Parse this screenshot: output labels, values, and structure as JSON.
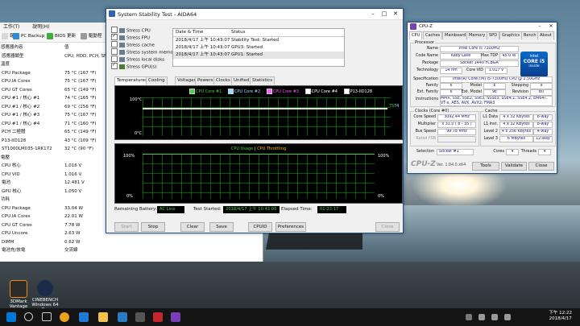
{
  "desktop": {
    "icons": [
      {
        "label": "3DMark Vantage"
      },
      {
        "label": "CINEBENCH Windows 64 B..."
      }
    ]
  },
  "sensor_window": {
    "menu": [
      "工作(T)",
      "說明(H)"
    ],
    "toolbar": [
      "報告",
      "PC Backup",
      "BIOS 更新",
      "驅動程"
    ],
    "header_col": "值",
    "rows": [
      {
        "name": "感應器內容",
        "value": ""
      },
      {
        "name": "感應器類型",
        "value": "CPU, HDD, PCH, SNB"
      },
      {
        "name": "溫度",
        "value": ""
      },
      {
        "name": "CPU Package",
        "value": "75 °C  (167 °F)"
      },
      {
        "name": "CPU IA Cores",
        "value": "75 °C  (167 °F)"
      },
      {
        "name": "CPU GT Cores",
        "value": "65 °C  (149 °F)"
      },
      {
        "name": "CPU #1 / 核心 #1",
        "value": "74 °C  (165 °F)"
      },
      {
        "name": "CPU #1 / 核心 #2",
        "value": "69 °C  (156 °F)"
      },
      {
        "name": "CPU #1 / 核心 #3",
        "value": "75 °C  (167 °F)"
      },
      {
        "name": "CPU #1 / 核心 #4",
        "value": "71 °C  (160 °F)"
      },
      {
        "name": "PCH 二極體",
        "value": "65 °C  (149 °F)"
      },
      {
        "name": "P13-IID128",
        "value": "43 °C  (109 °F)"
      },
      {
        "name": "ST1000LM035-1RK172",
        "value": "32 °C  (90 °F)"
      },
      {
        "name": "電壓",
        "value": ""
      },
      {
        "name": "CPU 核心",
        "value": "1.016 V"
      },
      {
        "name": "CPU VID",
        "value": "1.016 V"
      },
      {
        "name": "電池",
        "value": "12.481 V"
      },
      {
        "name": "GPU 核心",
        "value": "1.050 V"
      },
      {
        "name": "功耗",
        "value": ""
      },
      {
        "name": "CPU Package",
        "value": "33.04 W"
      },
      {
        "name": "CPU IA Cores",
        "value": "22.01 W"
      },
      {
        "name": "CPU GT Cores",
        "value": "7.78 W"
      },
      {
        "name": "CPU Uncore",
        "value": "2.63 W"
      },
      {
        "name": "DIMM",
        "value": "0.62 W"
      },
      {
        "name": "電池充/放電",
        "value": "交流線"
      }
    ]
  },
  "aida": {
    "title": "System Stability Test - AIDA64",
    "stress_options": [
      {
        "label": "Stress CPU",
        "checked": false
      },
      {
        "label": "Stress FPU",
        "checked": true
      },
      {
        "label": "Stress cache",
        "checked": false
      },
      {
        "label": "Stress system memory",
        "checked": false
      },
      {
        "label": "Stress local disks",
        "checked": false
      },
      {
        "label": "Stress GPU(s)",
        "checked": true
      }
    ],
    "log_headers": {
      "datetime": "Date & Time",
      "status": "Status"
    },
    "log": [
      {
        "datetime": "2018/4/17 上午 10:43:07",
        "status": "Stability Test: Started"
      },
      {
        "datetime": "2018/4/17 上午 10:43:07",
        "status": "GPU3: Started"
      },
      {
        "datetime": "2018/4/17 上午 10:43:07",
        "status": "GPU1: Started"
      }
    ],
    "tabs": [
      "Temperatures",
      "Cooling Fans",
      "Voltages",
      "Powers",
      "Clocks",
      "Unified",
      "Statistics"
    ],
    "temp_graph": {
      "legend": [
        "CPU Core #1",
        "CPU Core #2",
        "CPU Core #3",
        "CPU Core #4",
        "P13-IID128"
      ],
      "legend_colors": [
        "#46d246",
        "#8fe0ff",
        "#ff5cff",
        "#ffffff",
        "#ffffff"
      ],
      "y_top": "100°C",
      "y_bottom": "0°C",
      "current_a": "75",
      "current_b": "74"
    },
    "usage_graph": {
      "title_a": "CPU Usage",
      "title_sep": "|",
      "title_b": "CPU Throttling",
      "y_top_left": "100%",
      "y_bottom_left": "0%",
      "y_top_right": "100%",
      "y_bottom_right": "0%"
    },
    "info": {
      "battery_label": "Remaining Battery:",
      "battery_value": "AC Line",
      "started_label": "Test Started:",
      "started_value": "2018/4/17 上午 10:43:06",
      "elapsed_label": "Elapsed Time:",
      "elapsed_value": "01:23:17"
    },
    "buttons": [
      "Start",
      "Stop",
      "Clear",
      "Save",
      "CPUID",
      "Preferences",
      "Close"
    ]
  },
  "cpuz": {
    "title": "CPU-Z",
    "tabs": [
      "CPU",
      "Caches",
      "Mainboard",
      "Memory",
      "SPD",
      "Graphics",
      "Bench",
      "About"
    ],
    "processor_legend": "Processor",
    "name_label": "Name",
    "name": "Intel Core i5 7300HQ",
    "codename_label": "Code Name",
    "codename": "Kaby Lake",
    "maxtdp_label": "Max TDP",
    "maxtdp": "45.0 W",
    "package_label": "Package",
    "package": "Socket 1440 FCBGA",
    "technology_label": "Technology",
    "technology": "14 nm",
    "corevid_label": "Core VID",
    "corevid": "1.017 V",
    "spec_label": "Specification",
    "spec": "Intel(R) Core(TM) i5-7300HQ CPU @ 2.50GHz",
    "family_label": "Family",
    "family": "6",
    "model_label": "Model",
    "model": "E",
    "stepping_label": "Stepping",
    "stepping": "9",
    "extfamily_label": "Ext. Family",
    "extfamily": "6",
    "extmodel_label": "Ext. Model",
    "extmodel": "9E",
    "revision_label": "Revision",
    "revision": "B0",
    "instr_label": "Instructions",
    "instr": "MMX, SSE, SSE2, SSE3, SSSE3, SSE4.1, SSE4.2, EM64T, VT-x, AES, AVX, AVX2, FMA3",
    "clocks_legend": "Clocks (Core #0)",
    "corespeed_label": "Core Speed",
    "corespeed": "3092.44 MHz",
    "multiplier_label": "Multiplier",
    "multiplier": "x 31.0 ( 8 - 35 )",
    "busspeed_label": "Bus Speed",
    "busspeed": "99.78 MHz",
    "ratedfsb_label": "Rated FSB",
    "ratedfsb": "",
    "cache_legend": "Cache",
    "l1d_label": "L1 Data",
    "l1d": "4 x 32 KBytes",
    "l1d_way": "8-way",
    "l1i_label": "L1 Inst.",
    "l1i": "4 x 32 KBytes",
    "l1i_way": "8-way",
    "l2_label": "Level 2",
    "l2": "4 x 256 KBytes",
    "l2_way": "4-way",
    "l3_label": "Level 3",
    "l3": "6 MBytes",
    "l3_way": "12-way",
    "selection_label": "Selection",
    "selection": "Socket #1",
    "cores_label": "Cores",
    "cores": "4",
    "threads_label": "Threads",
    "threads": "4",
    "brand": "CPU-Z",
    "version": "Ver. 1.84.0.x64",
    "tools": "Tools",
    "validate": "Validate",
    "close": "Close",
    "logo_line1": "intel",
    "logo_line2": "CORE i5",
    "logo_line3": "inside"
  },
  "taskbar": {
    "time": "下午 12:22",
    "date": "2018/4/17"
  }
}
